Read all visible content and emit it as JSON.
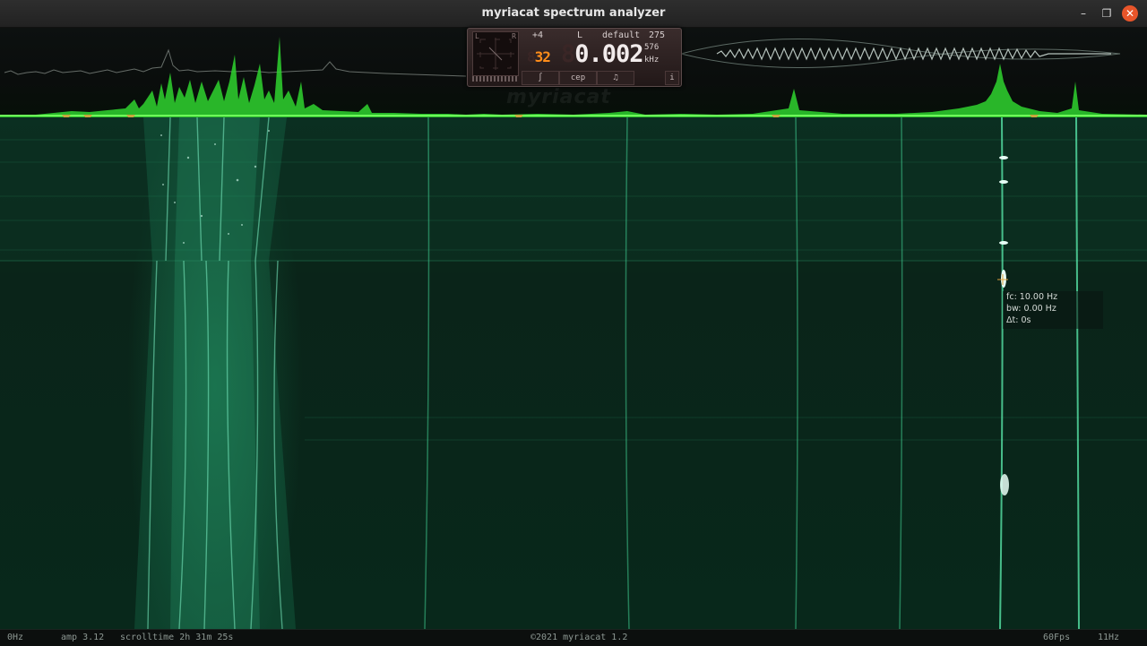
{
  "window": {
    "title": "myriacat spectrum analyzer",
    "minimize_icon": "minimize-icon",
    "maximize_icon": "maximize-icon",
    "close_icon": "close-icon"
  },
  "panel": {
    "scope_left": "L",
    "scope_right": "R",
    "offset": "+4",
    "channel": "L",
    "preset": "default",
    "frame": "275",
    "small_value_ghost": "8",
    "small_value": "32",
    "big_value_ghost": "8",
    "big_value": "0.002",
    "sample_count": "576",
    "unit": "kHz",
    "buttons": {
      "harmonics_icon": "harmonics-icon",
      "cep": "cep",
      "music_icon": "music-note-icon",
      "info": "i"
    }
  },
  "watermark": "myriacat",
  "cursor_info": {
    "fc": "fc: 10.00 Hz",
    "bw": "bw: 0.00 Hz",
    "dt": "Δt: 0s"
  },
  "statusbar": {
    "left_freq": "0Hz",
    "amp": "amp 3.12",
    "scrolltime": "scrolltime 2h 31m 25s",
    "copyright": "©2021 myriacat 1.2",
    "fps": "60Fps",
    "right_freq": "11Hz"
  },
  "colors": {
    "spectrum": "#3cff3c",
    "waterfall_bg": "#0a2519",
    "marker": "#c9a63d",
    "close": "#e8552a"
  }
}
